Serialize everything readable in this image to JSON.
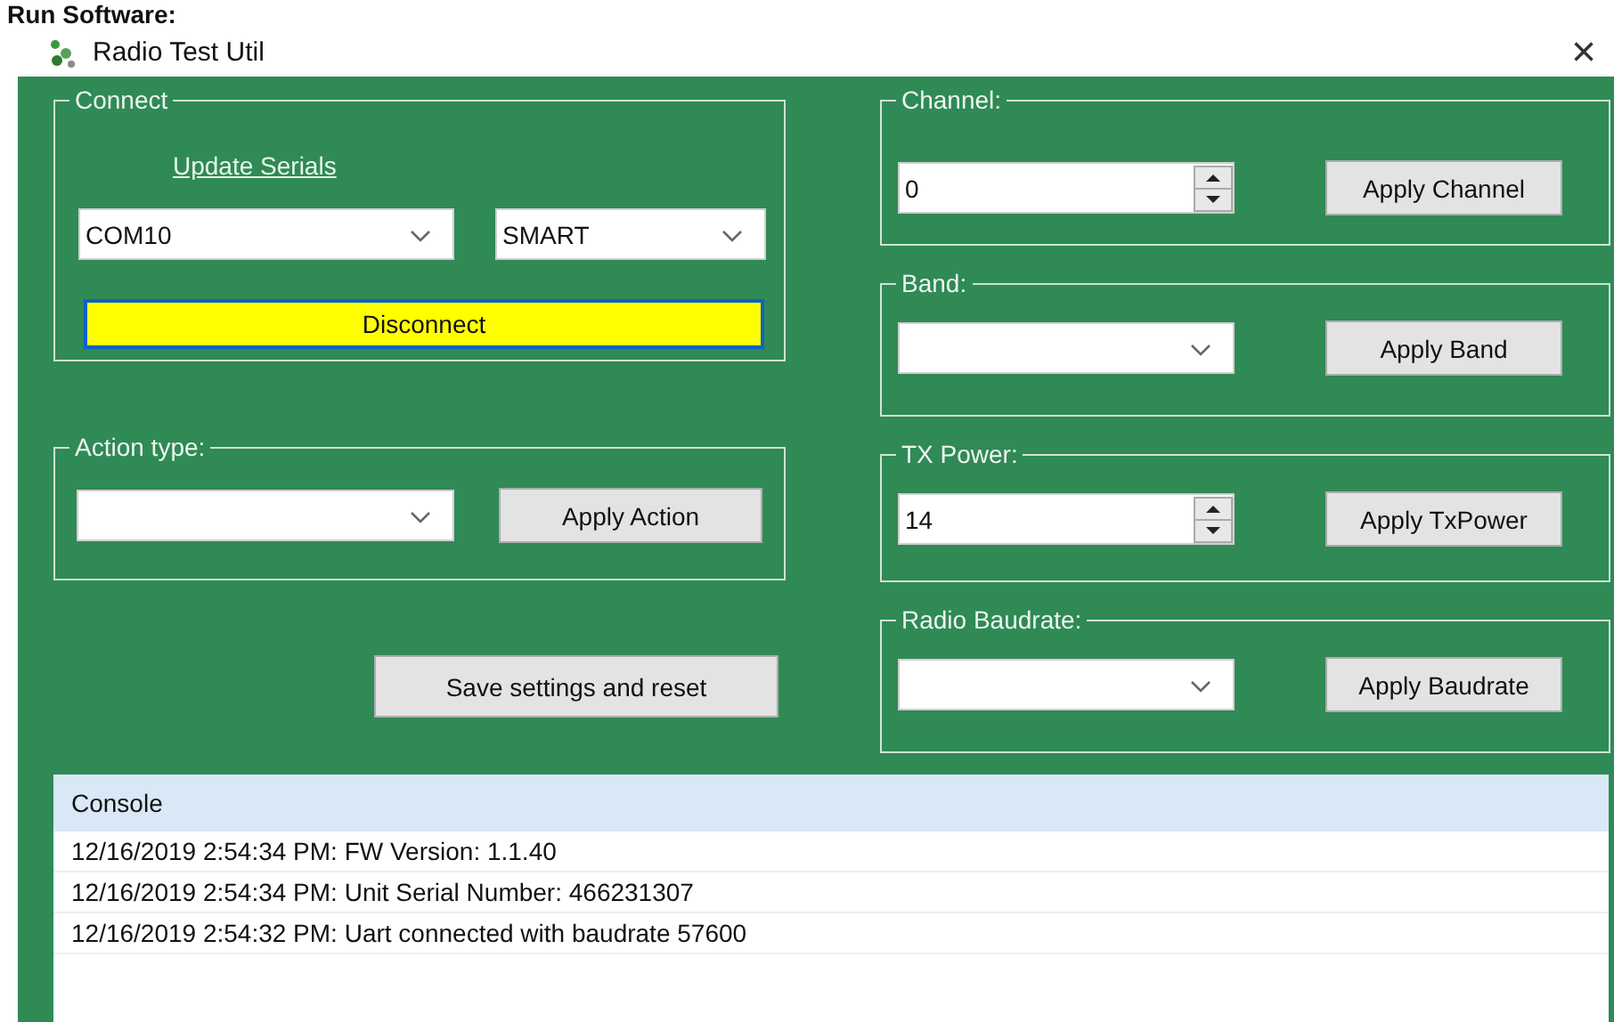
{
  "heading": "Run Software:",
  "window": {
    "title": "Radio Test Util",
    "close": "×"
  },
  "connect": {
    "title": "Connect",
    "link": "Update Serials",
    "port": {
      "kind": "combo",
      "value": "COM10"
    },
    "mode": {
      "kind": "combo",
      "value": "SMART"
    },
    "button": {
      "label": "Disconnect",
      "highlighted": true
    }
  },
  "action": {
    "title": "Action type:",
    "kind": "combo",
    "button": "Apply Action"
  },
  "save_button": "Save settings and reset",
  "settings": [
    {
      "title": "Channel:",
      "kind": "spin",
      "value": "0",
      "button": "Apply Channel"
    },
    {
      "title": "Band:",
      "kind": "combo",
      "button": "Apply Band"
    },
    {
      "title": "TX Power:",
      "kind": "spin",
      "value": "14",
      "button": "Apply TxPower"
    },
    {
      "title": "Radio Baudrate:",
      "kind": "combo",
      "button": "Apply Baudrate"
    }
  ],
  "console": {
    "header": "Console",
    "lines": [
      "12/16/2019 2:54:34 PM: FW Version: 1.1.40",
      "12/16/2019 2:54:34 PM: Unit Serial Number: 466231307",
      "12/16/2019 2:54:32 PM: Uart connected with baudrate 57600"
    ]
  }
}
